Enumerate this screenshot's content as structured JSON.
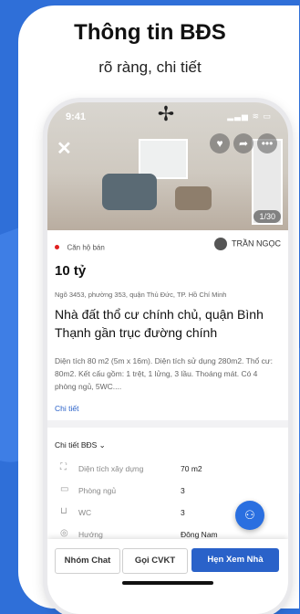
{
  "hero": {
    "title": "Thông tin BĐS",
    "subtitle": "rõ ràng, chi tiết"
  },
  "phone": {
    "status_time": "9:41",
    "status_right": "▂▃▅ ≋ ▭",
    "photo_counter": "1/30",
    "icons": [
      "close-icon",
      "heart-icon",
      "share-icon",
      "more-icon",
      "ceiling-fan-icon"
    ]
  },
  "listing": {
    "category": "Căn hộ bán",
    "agent": "TRẦN NGỌC",
    "price": "10 tỷ",
    "address": "Ngõ 3453, phường 353, quận Thủ Đức, TP. Hồ Chí Minh",
    "title": "Nhà đất thổ cư chính chủ, quận Bình Thạnh gần trục đường chính",
    "description": "Diện tích 80 m2 (5m x 16m). Diện tích sử dụng 280m2. Thổ cư: 80m2. Kết cấu gồm: 1 trệt, 1 lửng, 3 lầu. Thoáng mát. Có 4 phòng ngủ, 5WC....",
    "detail_link": "Chi tiết"
  },
  "details": {
    "header": "Chi tiết BĐS  ⌄",
    "rows": [
      {
        "icon": "area-icon",
        "label": "Diện tích xây dựng",
        "value": "70 m2"
      },
      {
        "icon": "bed-icon",
        "label": "Phòng ngủ",
        "value": "3"
      },
      {
        "icon": "toilet-icon",
        "label": "WC",
        "value": "3"
      },
      {
        "icon": "compass-icon",
        "label": "Hướng",
        "value": "Đông Nam"
      }
    ]
  },
  "actions": {
    "chat": "Nhóm Chat",
    "call": "Gọi CVKT",
    "book": "Hẹn Xem Nhà"
  },
  "colors": {
    "background": "#2f6fd8",
    "accent": "#2a62c9",
    "sale_dot": "#e02020"
  }
}
